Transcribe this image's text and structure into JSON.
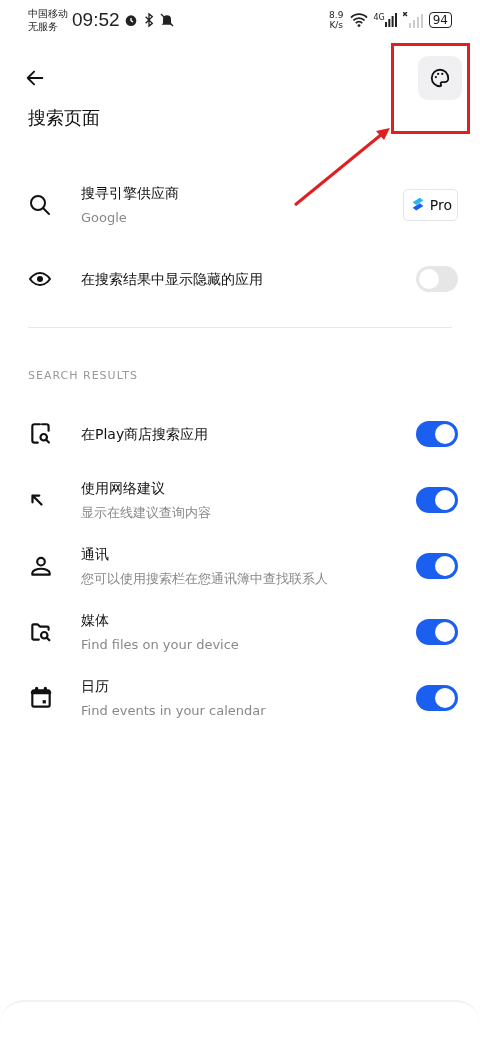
{
  "status_bar": {
    "carrier": "中国移动",
    "service": "无服务",
    "time": "09:52",
    "speed_value": "8.9",
    "speed_unit": "K/s",
    "network": "4G",
    "battery": "94"
  },
  "header": {
    "title": "搜索页面"
  },
  "top_items": [
    {
      "kind": "provider",
      "title": "搜寻引擎供应商",
      "subtitle": "Google",
      "badge": "Pro"
    },
    {
      "kind": "toggle",
      "title": "在搜索结果中显示隐藏的应用",
      "on": false
    }
  ],
  "section": {
    "heading": "SEARCH RESULTS"
  },
  "result_items": [
    {
      "title": "在Play商店搜索应用",
      "on": true
    },
    {
      "title": "使用网络建议",
      "subtitle": "显示在线建议查询内容",
      "on": true
    },
    {
      "title": "通讯",
      "subtitle": "您可以使用搜索栏在您通讯簿中查找联系人",
      "on": true
    },
    {
      "title": "媒体",
      "subtitle": "Find files on your device",
      "on": true
    },
    {
      "title": "日历",
      "subtitle": "Find events in your calendar",
      "on": true
    }
  ]
}
